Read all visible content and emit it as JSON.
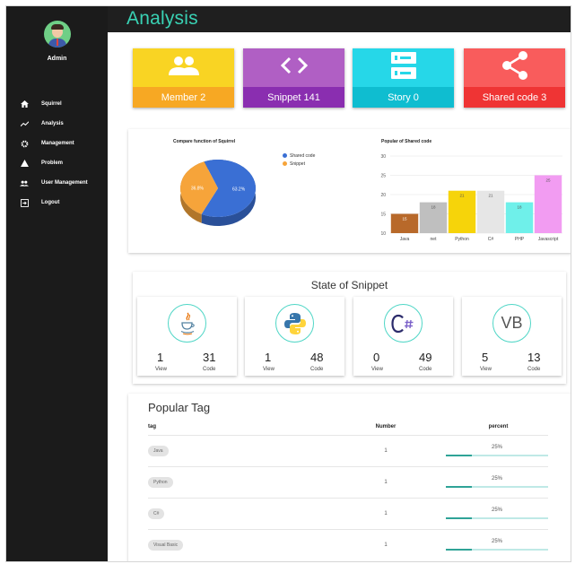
{
  "header": {
    "title": "Analysis"
  },
  "sidebar": {
    "username": "Admin",
    "items": [
      {
        "label": "Squirrel",
        "icon": "home-icon"
      },
      {
        "label": "Analysis",
        "icon": "trending-icon"
      },
      {
        "label": "Management",
        "icon": "gear-icon"
      },
      {
        "label": "Problem",
        "icon": "warning-icon"
      },
      {
        "label": "User Management",
        "icon": "users-icon"
      },
      {
        "label": "Logout",
        "icon": "logout-icon"
      }
    ]
  },
  "stats": [
    {
      "label": "Member 2",
      "icon": "group-icon",
      "color": "#f9d423",
      "band": "#f7a823"
    },
    {
      "label": "Snippet 141",
      "icon": "code-icon",
      "color": "#b05fc4",
      "band": "#8a2eb0"
    },
    {
      "label": "Story 0",
      "icon": "storage-icon",
      "color": "#26d7e8",
      "band": "#0fbdd0"
    },
    {
      "label": "Shared code 3",
      "icon": "share-icon",
      "color": "#f95c5c",
      "band": "#ef3434"
    }
  ],
  "pie_chart": {
    "chart_data": {
      "type": "pie",
      "title": "Compare function of Squirrel",
      "slices": [
        {
          "name": "Shared code",
          "value": 63.2,
          "label": "63.2%",
          "color": "#3a6fd4"
        },
        {
          "name": "Snippet",
          "value": 36.8,
          "label": "36.8%",
          "color": "#f6a43a"
        }
      ],
      "legend_position": "right"
    }
  },
  "bar_chart": {
    "chart_data": {
      "type": "bar",
      "title": "Popular of Shared code",
      "categories": [
        "Java",
        "net",
        "Python",
        "C#",
        "PHP",
        "Javascript"
      ],
      "values": [
        15,
        18,
        21,
        21,
        18,
        25
      ],
      "colors": [
        "#b8692a",
        "#bfbfbf",
        "#f6d40a",
        "#e6e6e6",
        "#6ff0ea",
        "#f29cf2"
      ],
      "ylim": [
        10,
        30
      ],
      "yticks": [
        10,
        15,
        20,
        25,
        30
      ],
      "grid": true
    }
  },
  "snippet_state": {
    "title": "State of Snippet",
    "view_label": "View",
    "code_label": "Code",
    "items": [
      {
        "lang": "java",
        "logo_icon": "java-icon",
        "view": "1",
        "code": "31"
      },
      {
        "lang": "python",
        "logo_icon": "python-icon",
        "view": "1",
        "code": "48"
      },
      {
        "lang": "csharp",
        "logo_icon": "csharp-icon",
        "view": "0",
        "code": "49"
      },
      {
        "lang": "vb",
        "logo_icon": "vb-icon",
        "logo_text": "VB",
        "view": "5",
        "code": "13"
      }
    ]
  },
  "popular_tag": {
    "title": "Popular Tag",
    "headers": {
      "tag": "tag",
      "number": "Number",
      "percent": "percent"
    },
    "rows": [
      {
        "tag": "Java",
        "number": "1",
        "percent": "25%",
        "fraction": 0.25
      },
      {
        "tag": "Python",
        "number": "1",
        "percent": "25%",
        "fraction": 0.25
      },
      {
        "tag": "C#",
        "number": "1",
        "percent": "25%",
        "fraction": 0.25
      },
      {
        "tag": "Visual Basic",
        "number": "1",
        "percent": "25%",
        "fraction": 0.25
      }
    ]
  }
}
